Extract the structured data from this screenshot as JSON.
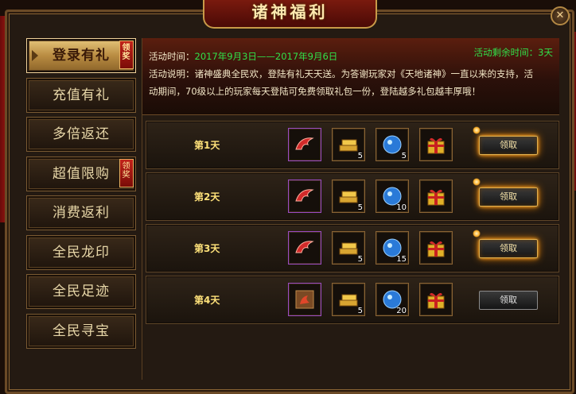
{
  "window": {
    "title": "诸神福利",
    "close_label": "✕"
  },
  "sidebar": {
    "items": [
      {
        "label": "登录有礼",
        "badge": "领奖",
        "active": true
      },
      {
        "label": "充值有礼",
        "badge": "",
        "active": false
      },
      {
        "label": "多倍返还",
        "badge": "",
        "active": false
      },
      {
        "label": "超值限购",
        "badge": "领奖",
        "active": false
      },
      {
        "label": "消费返利",
        "badge": "",
        "active": false
      },
      {
        "label": "全民龙印",
        "badge": "",
        "active": false
      },
      {
        "label": "全民足迹",
        "badge": "",
        "active": false
      },
      {
        "label": "全民寻宝",
        "badge": "",
        "active": false
      }
    ]
  },
  "event": {
    "time_label": "活动时间：",
    "time_value": "2017年9月3日——2017年9月6日",
    "remaining": "活动剩余时间：3天",
    "desc_line1": "活动说明：诸神盛典全民欢，登陆有礼天天送。为答谢玩家对《天地诸神》一直以来的支持，活",
    "desc_line2": "动期间，70级以上的玩家每天登陆可免费领取礼包一份，登陆越多礼包越丰厚哦！"
  },
  "days": [
    {
      "label": "第1天",
      "items": [
        {
          "icon": "red-wing-icon",
          "qty": ""
        },
        {
          "icon": "gold-bars-icon",
          "qty": "5"
        },
        {
          "icon": "blue-orb-icon",
          "qty": "5"
        },
        {
          "icon": "gift-box-icon",
          "qty": ""
        }
      ],
      "button": "领取",
      "available": true
    },
    {
      "label": "第2天",
      "items": [
        {
          "icon": "red-wing-icon",
          "qty": ""
        },
        {
          "icon": "gold-bars-icon",
          "qty": "5"
        },
        {
          "icon": "blue-orb-icon",
          "qty": "10"
        },
        {
          "icon": "gift-box-icon",
          "qty": ""
        }
      ],
      "button": "领取",
      "available": true
    },
    {
      "label": "第3天",
      "items": [
        {
          "icon": "red-wing-icon",
          "qty": ""
        },
        {
          "icon": "gold-bars-icon",
          "qty": "5"
        },
        {
          "icon": "blue-orb-icon",
          "qty": "15"
        },
        {
          "icon": "gift-box-icon",
          "qty": ""
        }
      ],
      "button": "领取",
      "available": true
    },
    {
      "label": "第4天",
      "items": [
        {
          "icon": "fire-scroll-icon",
          "qty": ""
        },
        {
          "icon": "gold-bars-icon",
          "qty": "5"
        },
        {
          "icon": "blue-orb-icon",
          "qty": "20"
        },
        {
          "icon": "gift-box-icon",
          "qty": ""
        }
      ],
      "button": "领取",
      "available": false
    }
  ],
  "colors": {
    "accent_gold": "#e7c77c",
    "highlight_green": "#31e04a",
    "day_label": "#ffe27a"
  }
}
